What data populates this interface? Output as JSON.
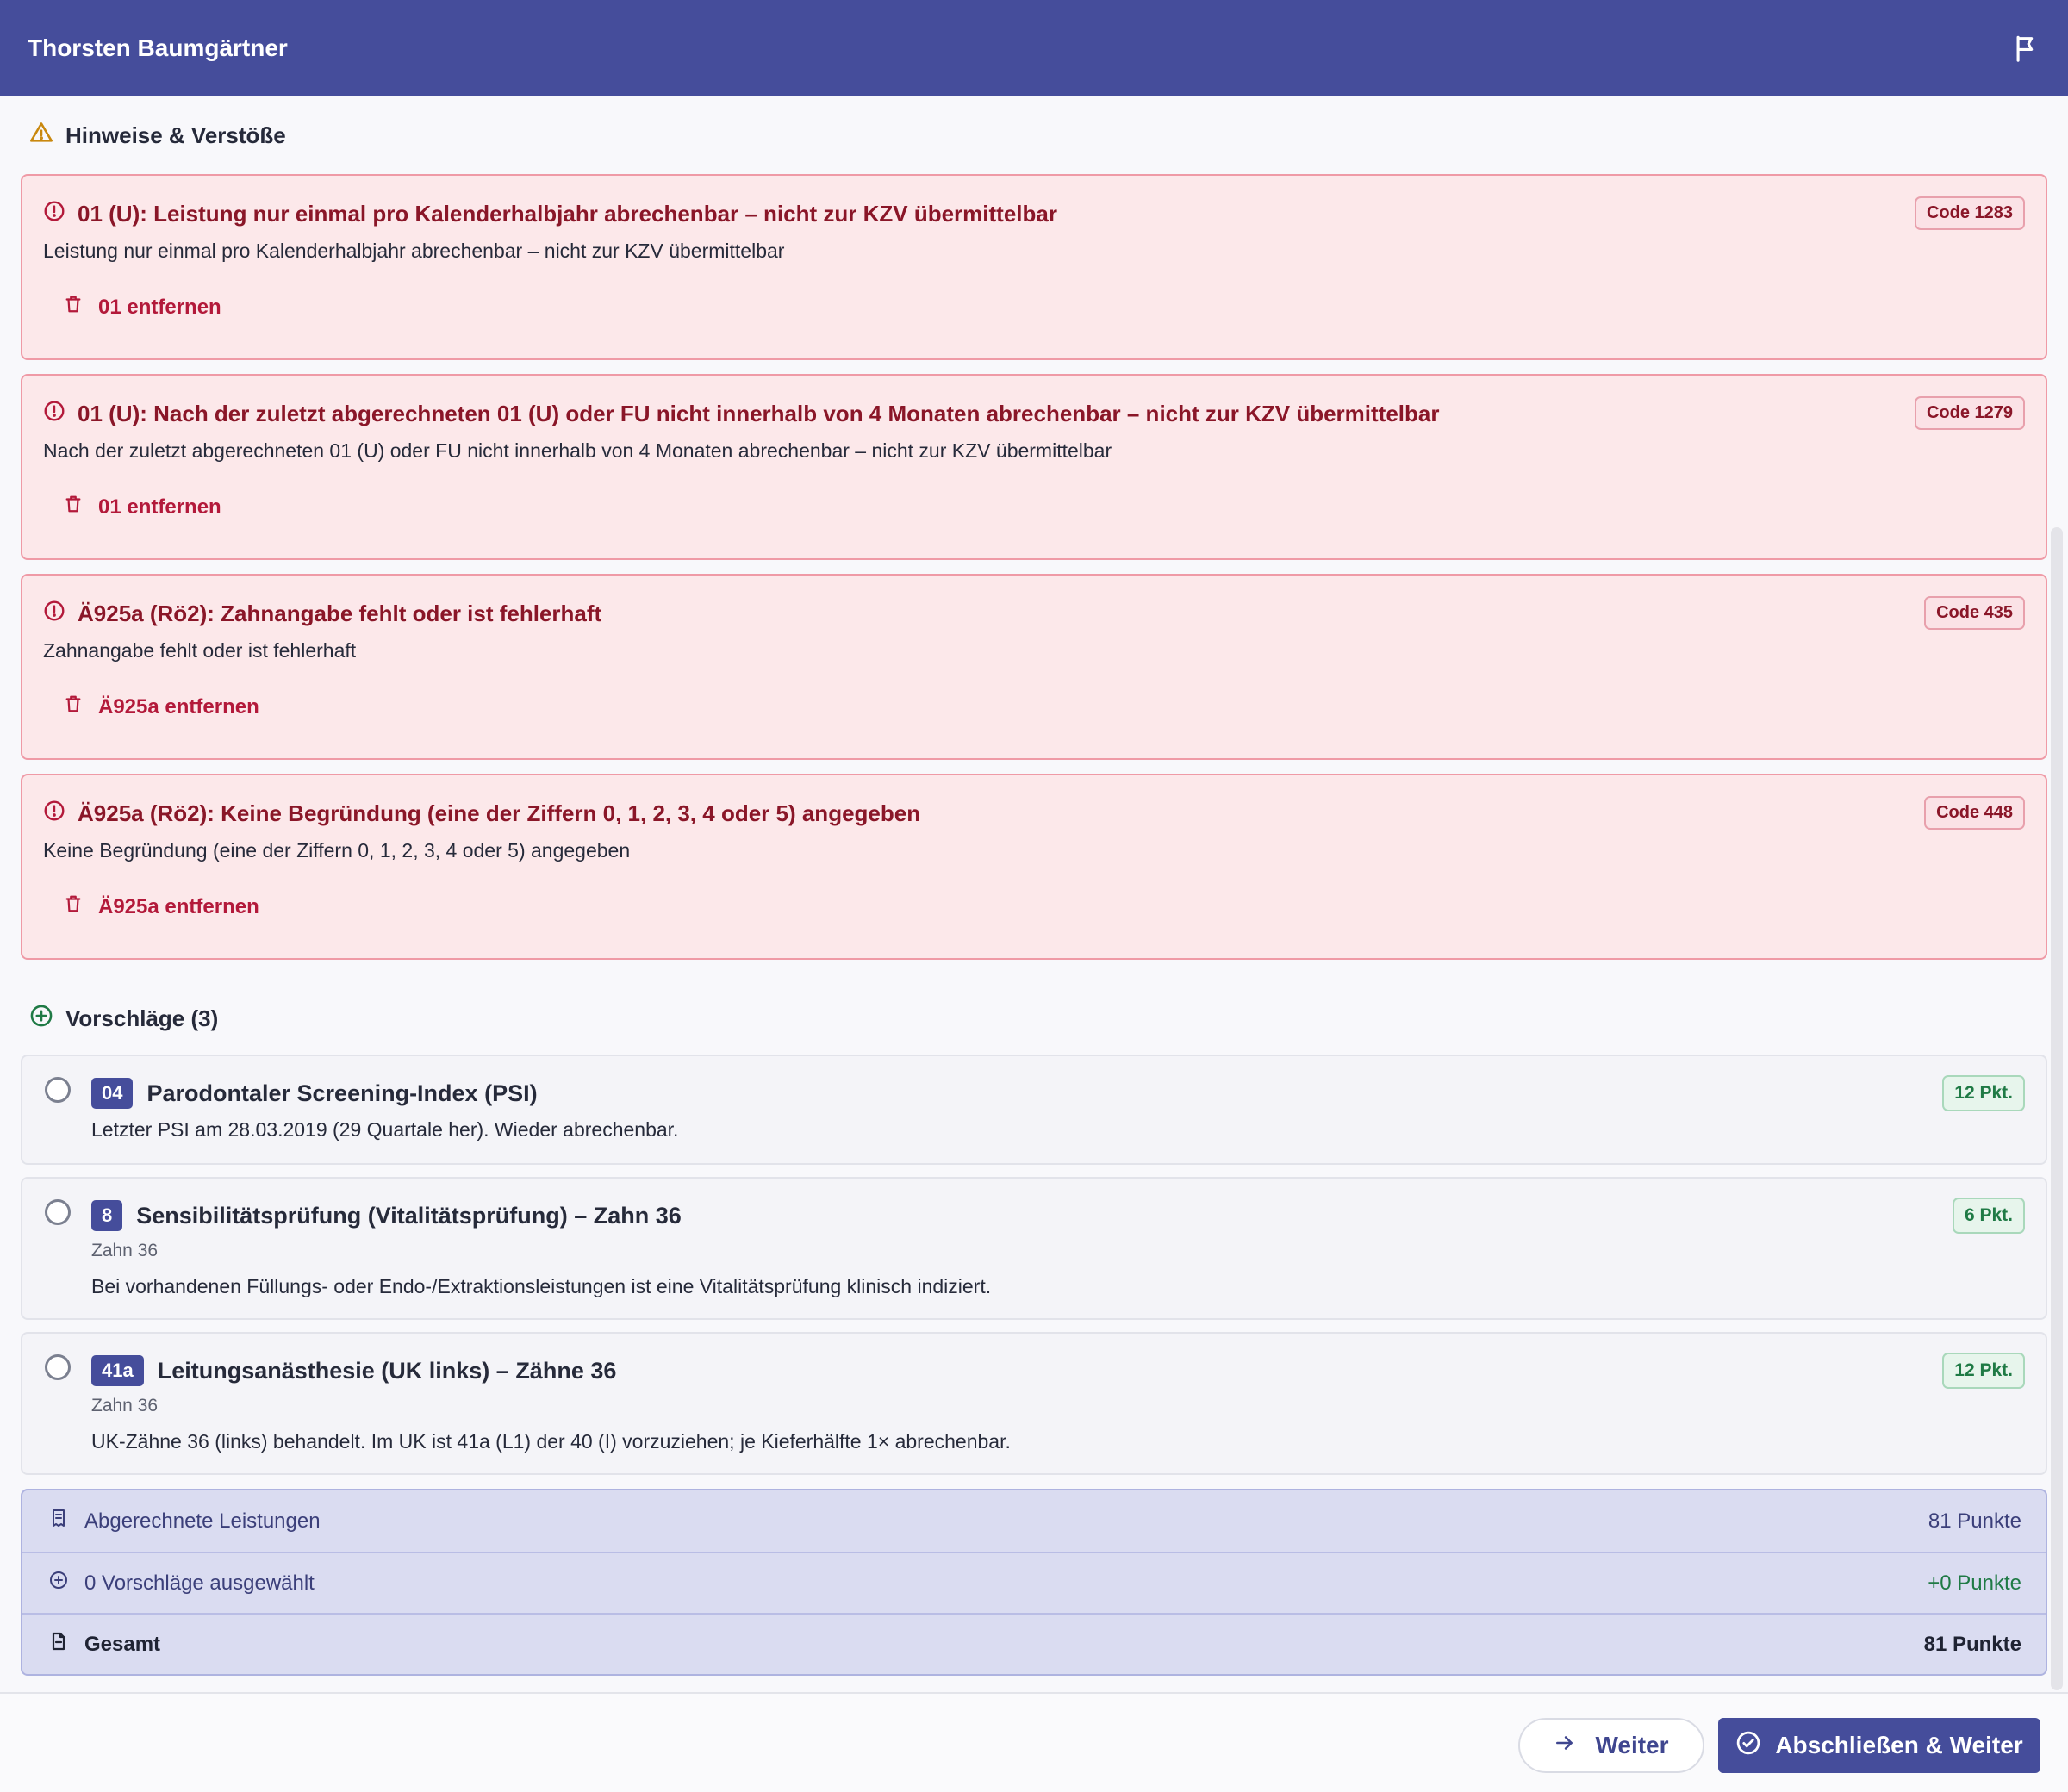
{
  "header": {
    "title": "Thorsten Baumgärtner",
    "flag_icon": "flag-icon"
  },
  "issues": {
    "heading": "Hinweise & Verstöße",
    "items": [
      {
        "title": "01 (U): Leistung nur einmal pro Kalenderhalbjahr abrechenbar – nicht zur KZV übermittelbar",
        "description": "Leistung nur einmal pro Kalenderhalbjahr abrechenbar – nicht zur KZV übermittelbar",
        "code": "Code 1283",
        "action": "01 entfernen"
      },
      {
        "title": "01 (U): Nach der zuletzt abgerechneten 01 (U) oder FU nicht innerhalb von 4 Monaten abrechenbar – nicht zur KZV übermittelbar",
        "description": "Nach der zuletzt abgerechneten 01 (U) oder FU nicht innerhalb von 4 Monaten abrechenbar – nicht zur KZV übermittelbar",
        "code": "Code 1279",
        "action": "01 entfernen"
      },
      {
        "title": "Ä925a (Rö2): Zahnangabe fehlt oder ist fehlerhaft",
        "description": "Zahnangabe fehlt oder ist fehlerhaft",
        "code": "Code 435",
        "action": "Ä925a entfernen"
      },
      {
        "title": "Ä925a (Rö2): Keine Begründung (eine der Ziffern 0, 1, 2, 3, 4 oder 5) angegeben",
        "description": "Keine Begründung (eine der Ziffern 0, 1, 2, 3, 4 oder 5) angegeben",
        "code": "Code 448",
        "action": "Ä925a entfernen"
      }
    ]
  },
  "suggestions": {
    "heading": "Vorschläge (3)",
    "items": [
      {
        "number": "04",
        "title": "Parodontaler Screening-Index (PSI)",
        "subtitle": "",
        "description": "Letzter PSI am 28.03.2019 (29 Quartale her). Wieder abrechenbar.",
        "points": "12 Pkt.",
        "selected": false
      },
      {
        "number": "8",
        "title": "Sensibilitätsprüfung (Vitalitätsprüfung) – Zahn 36",
        "subtitle": "Zahn 36",
        "description": "Bei vorhandenen Füllungs- oder Endo-/Extraktionsleistungen ist eine Vitalitätsprüfung klinisch indiziert.",
        "points": "6 Pkt.",
        "selected": false
      },
      {
        "number": "41a",
        "title": "Leitungsanästhesie (UK links) – Zähne 36",
        "subtitle": "Zahn 36",
        "description": "UK-Zähne 36 (links) behandelt. Im UK ist 41a (L1) der 40 (I) vorzuziehen; je Kieferhälfte 1× abrechenbar.",
        "points": "12 Pkt.",
        "selected": false
      }
    ]
  },
  "summary": {
    "billed_label": "Abgerechnete Leistungen",
    "billed_value": "81 Punkte",
    "selected_label": "0 Vorschläge ausgewählt",
    "selected_value": "+0 Punkte",
    "total_label": "Gesamt",
    "total_value": "81 Punkte"
  },
  "footer": {
    "next_label": "Weiter",
    "finish_label": "Abschließen & Weiter"
  },
  "colors": {
    "primary": "#454d9b",
    "error_bg": "#fce8ea",
    "error_text": "#8a1628",
    "warning": "#c9880e",
    "success": "#1f7a45"
  }
}
